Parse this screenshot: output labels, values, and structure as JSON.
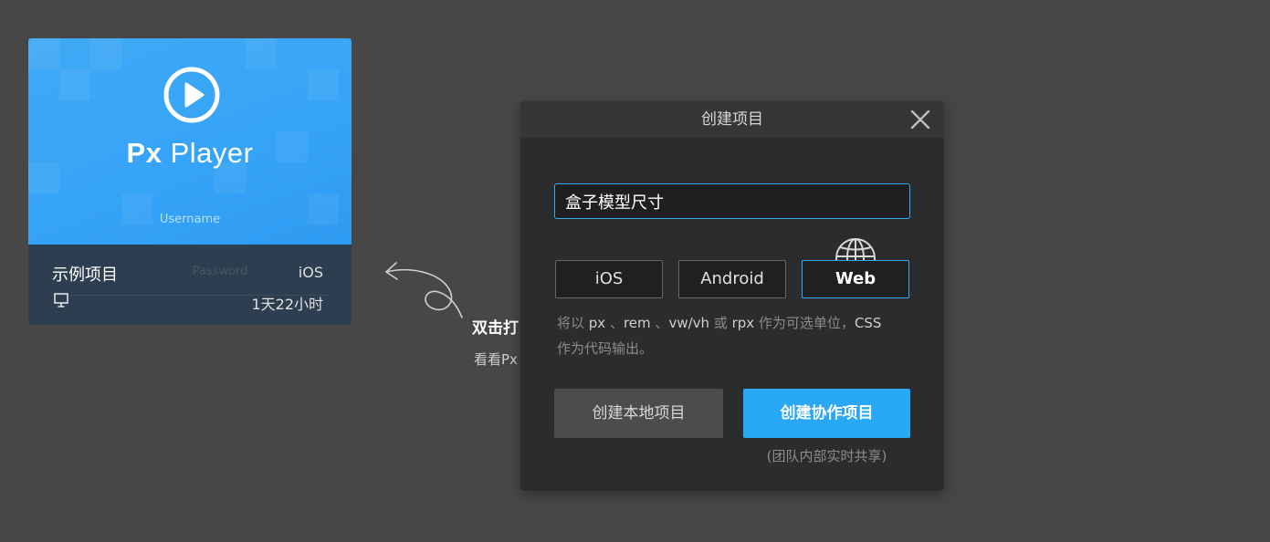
{
  "card": {
    "brand_prefix": "Px",
    "brand_name": "Player",
    "username_text": "Username",
    "password_text": "Password",
    "title": "示例项目",
    "platform": "iOS",
    "time": "1天22小时"
  },
  "hint": {
    "title": "双击打",
    "subtitle": "看看Px"
  },
  "dialog": {
    "title": "创建项目",
    "project_name_value": "盒子模型尺寸",
    "platforms": [
      "iOS",
      "Android",
      "Web"
    ],
    "selected_platform": "Web",
    "desc": {
      "t1": "将以 ",
      "u1": "px",
      "t2": " 、",
      "u2": "rem",
      "t3": " 、",
      "u3": "vw/vh",
      "t4": " 或 ",
      "u4": "rpx",
      "t5": " 作为可选单位，",
      "u5": "CSS",
      "t6": " 作为代码输出。"
    },
    "create_local_label": "创建本地项目",
    "create_collab_label": "创建协作项目",
    "collab_note": "(团队内部实时共享)"
  },
  "colors": {
    "background": "#474747",
    "accent": "#29a8f5",
    "card_blue": "#3fa9f5",
    "card_meta": "#2c3e50",
    "dialog": "#2b2c2e"
  },
  "icons": [
    "play-circle-icon",
    "monitor-icon",
    "curved-arrow-icon",
    "close-icon",
    "globe-icon"
  ]
}
